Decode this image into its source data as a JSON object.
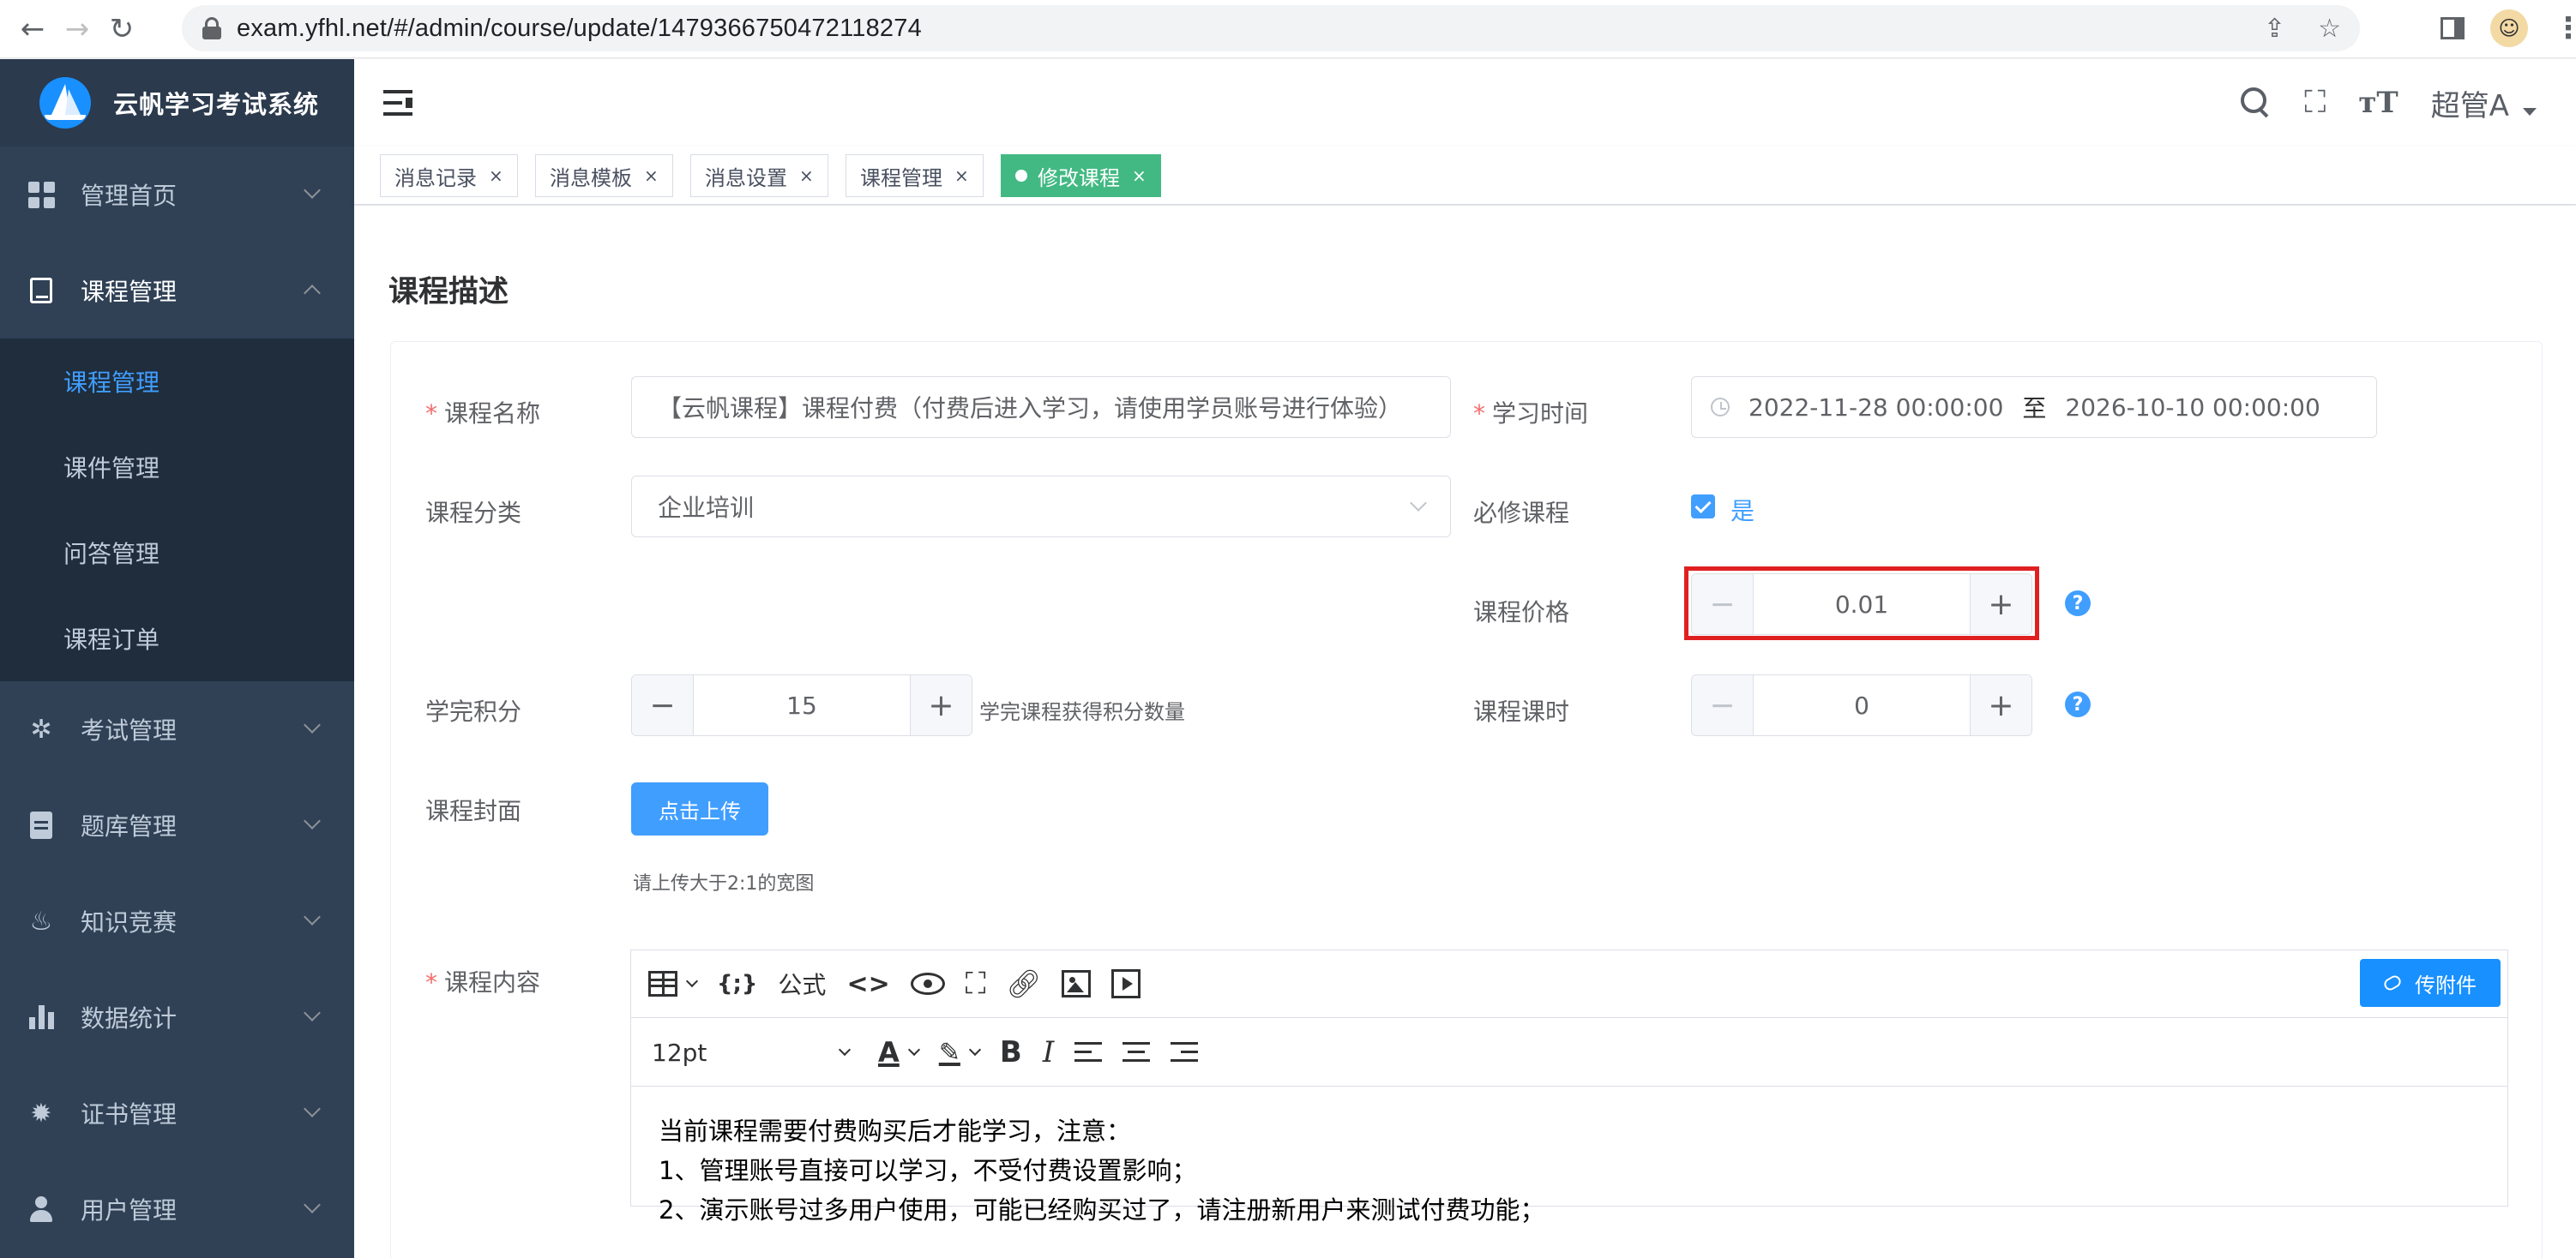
{
  "browser": {
    "url": "exam.yfhl.net/#/admin/course/update/1479366750472118274"
  },
  "sidebar": {
    "brand": "云帆学习考试系统",
    "menu": [
      {
        "label": "管理首页",
        "icon": "dashboard-icon"
      },
      {
        "label": "课程管理",
        "icon": "book-icon",
        "open": true
      },
      {
        "label": "考试管理",
        "icon": "exam-icon"
      },
      {
        "label": "题库管理",
        "icon": "document-icon"
      },
      {
        "label": "知识竞赛",
        "icon": "fire-icon"
      },
      {
        "label": "数据统计",
        "icon": "bar-chart-icon"
      },
      {
        "label": "证书管理",
        "icon": "certificate-icon"
      },
      {
        "label": "用户管理",
        "icon": "user-icon"
      }
    ],
    "submenu": [
      "课程管理",
      "课件管理",
      "问答管理",
      "课程订单"
    ],
    "active_sub": "课程管理"
  },
  "navbar": {
    "user": "超管A"
  },
  "tags": [
    {
      "label": "消息记录"
    },
    {
      "label": "消息模板"
    },
    {
      "label": "消息设置"
    },
    {
      "label": "课程管理"
    },
    {
      "label": "修改课程",
      "active": true
    }
  ],
  "form": {
    "section_title": "课程描述",
    "course_name": {
      "label": "课程名称",
      "value": "【云帆课程】课程付费（付费后进入学习，请使用学员账号进行体验）"
    },
    "study_time": {
      "label": "学习时间",
      "start": "2022-11-28 00:00:00",
      "separator": "至",
      "end": "2026-10-10 00:00:00"
    },
    "category": {
      "label": "课程分类",
      "value": "企业培训"
    },
    "required": {
      "label": "必修课程",
      "checkbox_label": "是",
      "checked": true
    },
    "price": {
      "label": "课程价格",
      "value": "0.01"
    },
    "points": {
      "label": "学完积分",
      "value": "15",
      "hint": "学完课程获得积分数量"
    },
    "hours": {
      "label": "课程课时",
      "value": "0"
    },
    "cover": {
      "label": "课程封面",
      "button": "点击上传",
      "tip": "请上传大于2:1的宽图"
    },
    "content": {
      "label": "课程内容",
      "toolbar": {
        "formula": "公式",
        "attach": "传附件",
        "font_size": "12pt"
      },
      "lines": [
        "当前课程需要付费购买后才能学习，注意：",
        "1、管理账号直接可以学习，不受付费设置影响；",
        "2、演示账号过多用户使用，可能已经购买过了，请注册新用户来测试付费功能；"
      ]
    }
  },
  "colors": {
    "sidebar_bg": "#304156",
    "primary": "#409eff",
    "active_tag": "#42b983",
    "highlight": "#e02020"
  }
}
